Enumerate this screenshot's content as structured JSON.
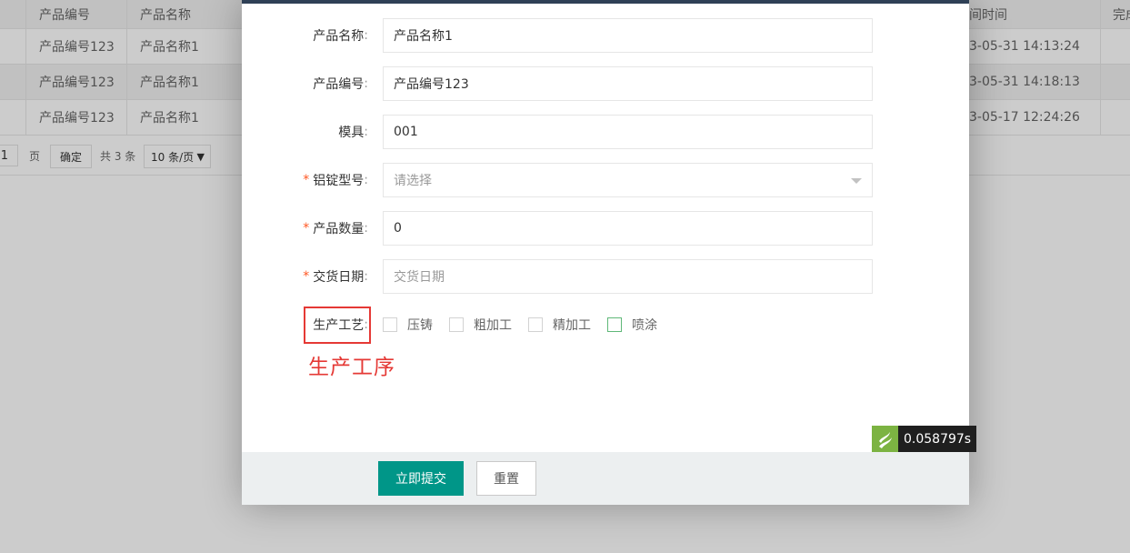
{
  "table": {
    "headers": [
      {
        "key": "prev_partial",
        "text": ""
      },
      {
        "key": "product_no",
        "text": "产品编号"
      },
      {
        "key": "product_name",
        "text": "产品名称"
      },
      {
        "key": "time",
        "text": "间时间"
      },
      {
        "key": "status_partial",
        "text": "完成"
      }
    ],
    "rows": [
      {
        "product_no": "产品编号123",
        "product_name": "产品名称1",
        "time": "3-05-31 14:13:24"
      },
      {
        "product_no": "产品编号123",
        "product_name": "产品名称1",
        "time": "3-05-31 14:18:13"
      },
      {
        "product_no": "产品编号123",
        "product_name": "产品名称1",
        "time": "3-05-17 12:24:26"
      }
    ]
  },
  "pager": {
    "page_value": "1",
    "page_suffix": "页",
    "confirm_label": "确定",
    "total_text": "共 3 条",
    "per_page": "10 条/页"
  },
  "form": {
    "product_name": {
      "label": "产品名称",
      "value": "产品名称1"
    },
    "product_no": {
      "label": "产品编号",
      "value": "产品编号123"
    },
    "mold": {
      "label": "模具",
      "value": "001"
    },
    "ingot_model": {
      "label": "铝锭型号",
      "placeholder": "请选择",
      "required": true
    },
    "quantity": {
      "label": "产品数量",
      "value": "0",
      "required": true
    },
    "delivery_date": {
      "label": "交货日期",
      "placeholder": "交货日期",
      "required": true
    },
    "process": {
      "label": "生产工艺",
      "options": [
        {
          "label": "压铸",
          "checked": false
        },
        {
          "label": "粗加工",
          "checked": false
        },
        {
          "label": "精加工",
          "checked": false
        },
        {
          "label": "喷涂",
          "checked": false
        }
      ]
    },
    "required_mark": "*",
    "colon": ":"
  },
  "annotation": {
    "text": "生产工序",
    "color": "#e53935"
  },
  "buttons": {
    "submit": "立即提交",
    "reset": "重置"
  },
  "timer": {
    "value": "0.058797s"
  },
  "colors": {
    "primary": "#009688",
    "header_bar": "#2f4056",
    "required": "#ff5722",
    "checkbox_active": "#5FB878"
  }
}
